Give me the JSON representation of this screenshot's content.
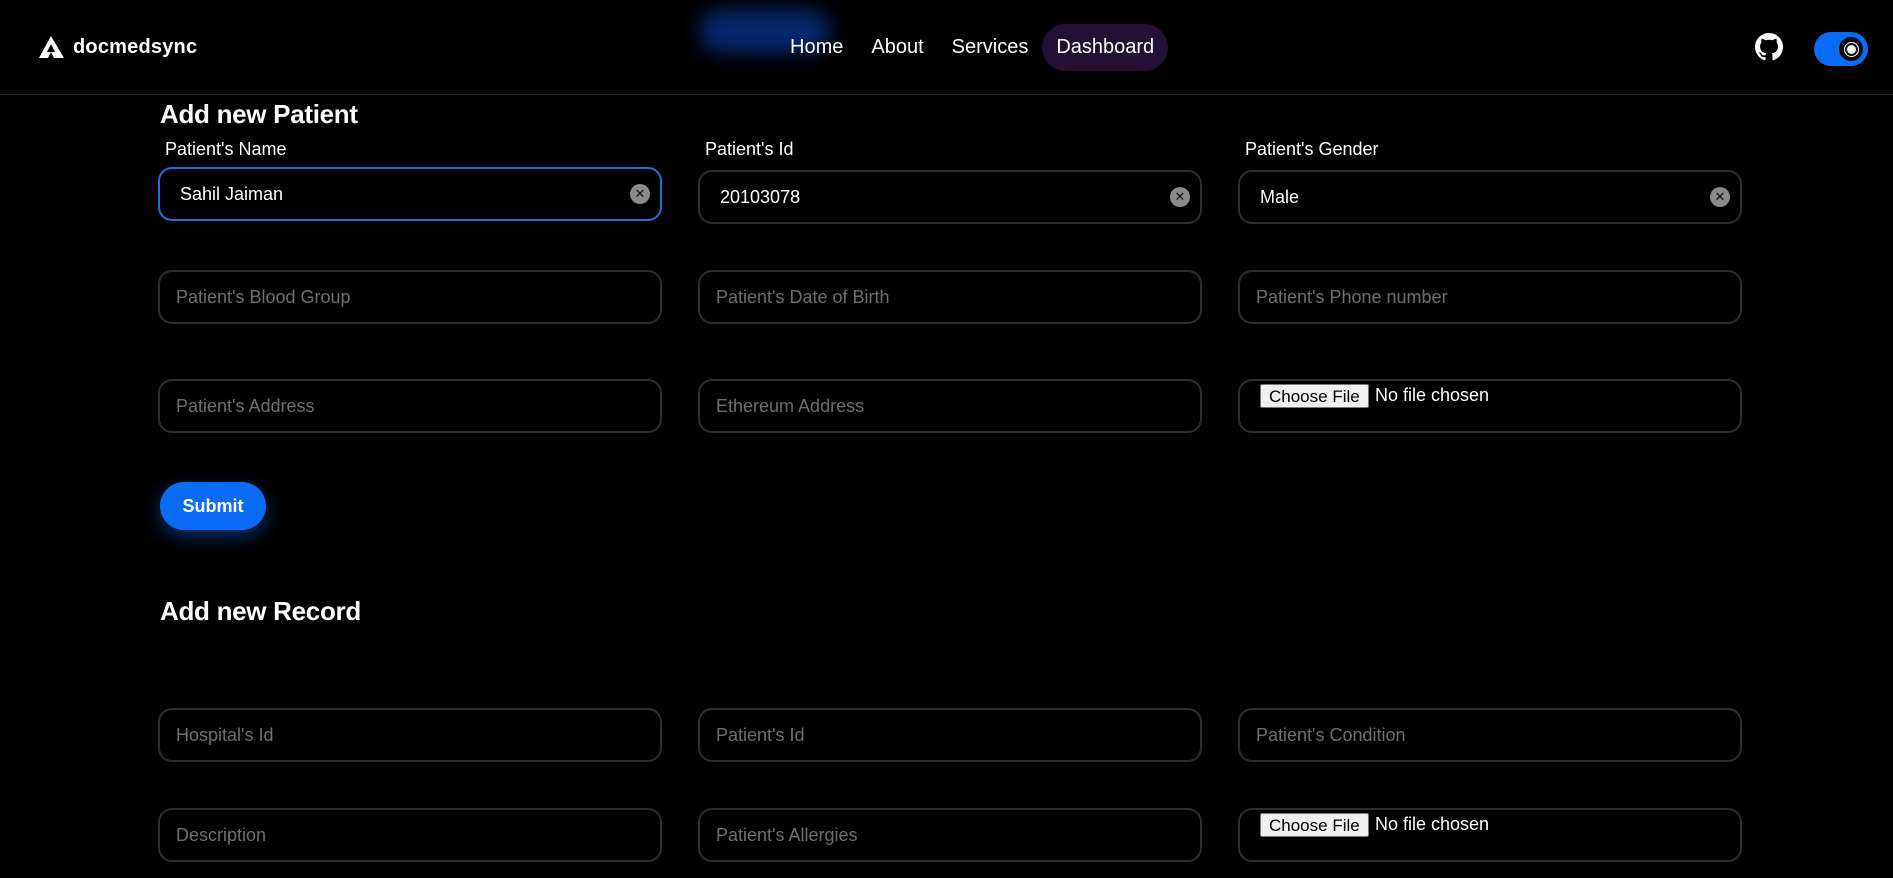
{
  "nav": {
    "brand": "docmedsync",
    "links": [
      "Home",
      "About",
      "Services",
      "Dashboard"
    ],
    "active": "Dashboard",
    "github_icon": "github-icon",
    "theme_toggle": "on"
  },
  "patient_form": {
    "title": "Add new Patient",
    "name_label": "Patient's Name",
    "name_value": "Sahil Jaiman",
    "id_label": "Patient's Id",
    "id_value": "20103078",
    "gender_label": "Patient's Gender",
    "gender_value": "Male",
    "blood_group_placeholder": "Patient's Blood Group",
    "dob_placeholder": "Patient's Date of Birth",
    "phone_placeholder": "Patient's Phone number",
    "address_placeholder": "Patient's Address",
    "eth_placeholder": "Ethereum Address",
    "file_button": "Choose File",
    "file_status": "No file chosen",
    "submit": "Submit"
  },
  "record_form": {
    "title": "Add new Record",
    "hospital_id_placeholder": "Hospital's Id",
    "patient_id_placeholder": "Patient's Id",
    "condition_placeholder": "Patient's Condition",
    "description_placeholder": "Description",
    "allergies_placeholder": "Patient's Allergies",
    "file_button": "Choose File",
    "file_status": "No file chosen"
  },
  "colors": {
    "accent": "#0a6cf5",
    "active_nav_bg": "#241035",
    "background": "#000000"
  }
}
